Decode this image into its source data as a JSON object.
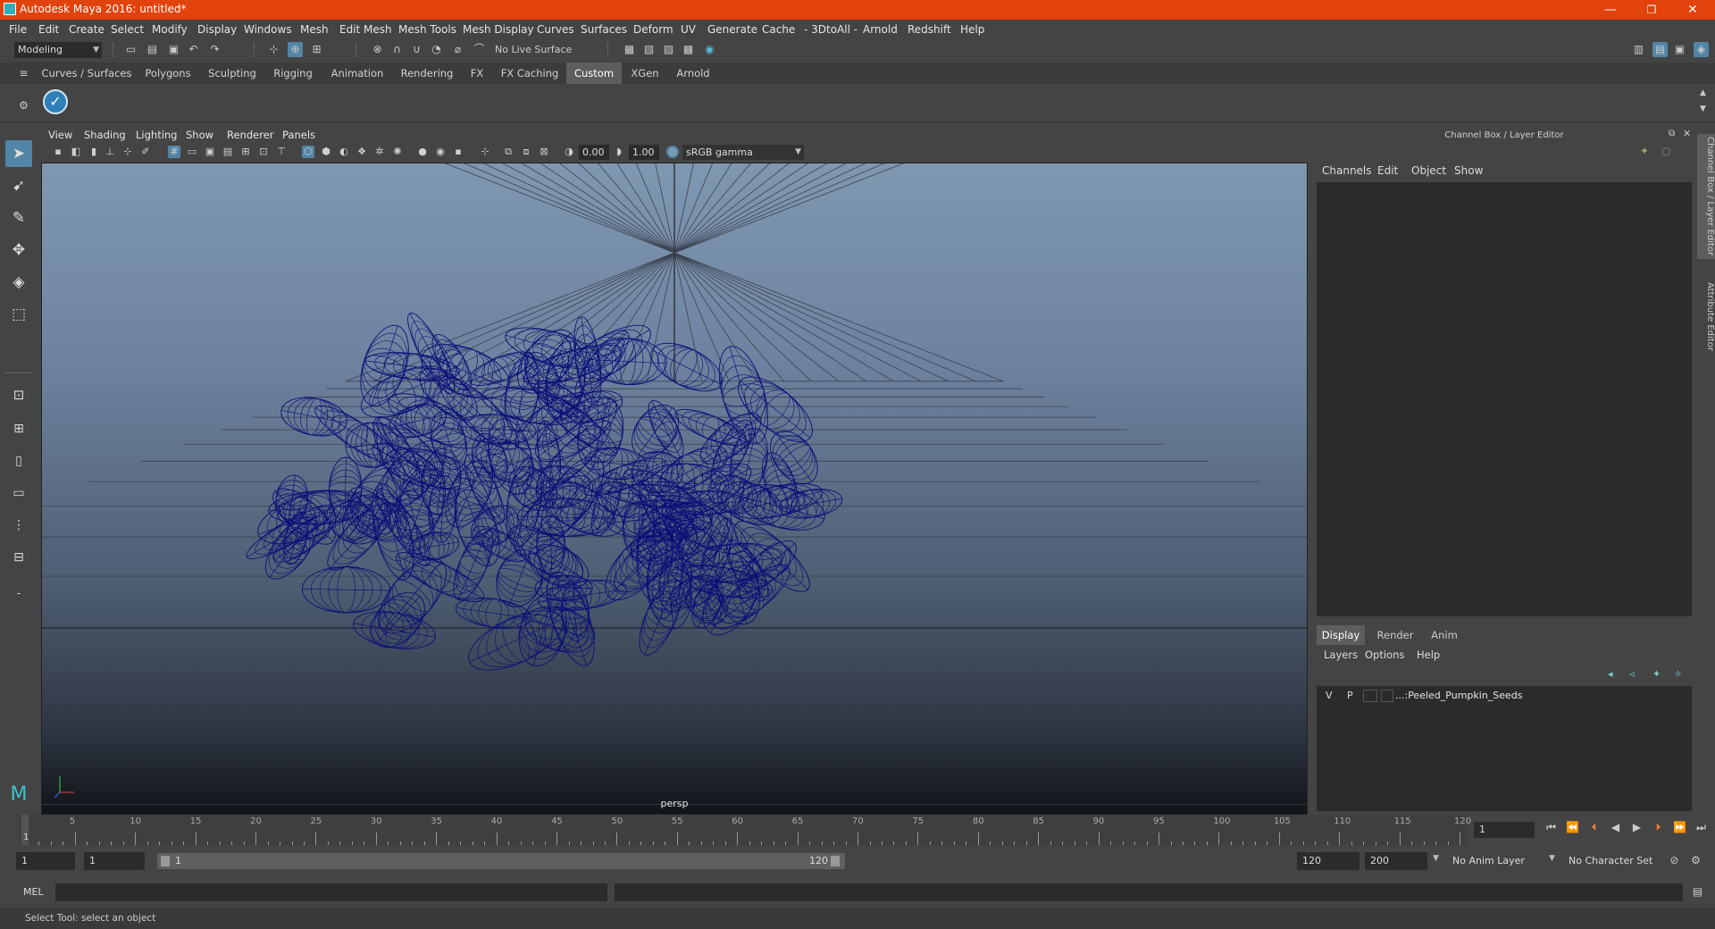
{
  "window": {
    "title": "Autodesk Maya 2016: untitled*",
    "minimize": "—",
    "restore": "❐",
    "close": "✕"
  },
  "menubar": [
    "File",
    "Edit",
    "Create",
    "Select",
    "Modify",
    "Display",
    "Windows",
    "Mesh",
    "Edit Mesh",
    "Mesh Tools",
    "Mesh Display",
    "Curves",
    "Surfaces",
    "Deform",
    "UV",
    "Generate",
    "Cache",
    "- 3DtoAll -",
    "Arnold",
    "Redshift",
    "Help"
  ],
  "statusline": {
    "mode": "Modeling",
    "live_surface": "No Live Surface"
  },
  "shelf_tabs": [
    "Curves / Surfaces",
    "Polygons",
    "Sculpting",
    "Rigging",
    "Animation",
    "Rendering",
    "FX",
    "FX Caching",
    "Custom",
    "XGen",
    "Arnold"
  ],
  "shelf_active": "Custom",
  "viewport": {
    "menus": [
      "View",
      "Shading",
      "Lighting",
      "Show",
      "Renderer",
      "Panels"
    ],
    "exposure": "0.00",
    "gamma": "1.00",
    "color_space": "sRGB gamma",
    "camera_label": "persp",
    "mesh_color": "#0a0f78"
  },
  "right_panel": {
    "title": "Channel Box / Layer Editor",
    "channel_menus": [
      "Channels",
      "Edit",
      "Object",
      "Show"
    ],
    "layer_tabs": [
      "Display",
      "Render",
      "Anim"
    ],
    "layer_menus": [
      "Layers",
      "Options",
      "Help"
    ],
    "layer_row": {
      "v": "V",
      "p": "P",
      "name": "...:Peeled_Pumpkin_Seeds"
    },
    "side_tabs": [
      "Channel Box / Layer Editor",
      "Attribute Editor"
    ]
  },
  "timeline": {
    "ticks": [
      "5",
      "10",
      "15",
      "20",
      "25",
      "30",
      "35",
      "40",
      "45",
      "50",
      "55",
      "60",
      "65",
      "70",
      "75",
      "80",
      "85",
      "90",
      "95",
      "100",
      "105",
      "110",
      "115",
      "120"
    ],
    "start_marker": "1",
    "current_frame": "1"
  },
  "range": {
    "start": "1",
    "playback_start": "1",
    "slider_start": "1",
    "slider_end": "120",
    "playback_end": "120",
    "end": "200",
    "anim_layer": "No Anim Layer",
    "character_set": "No Character Set"
  },
  "command": {
    "label": "MEL"
  },
  "help_line": "Select Tool: select an object",
  "colors": {
    "title_bar": "#e2420b",
    "accent": "#5285a6",
    "panel": "#444444",
    "field": "#2b2b2b"
  }
}
